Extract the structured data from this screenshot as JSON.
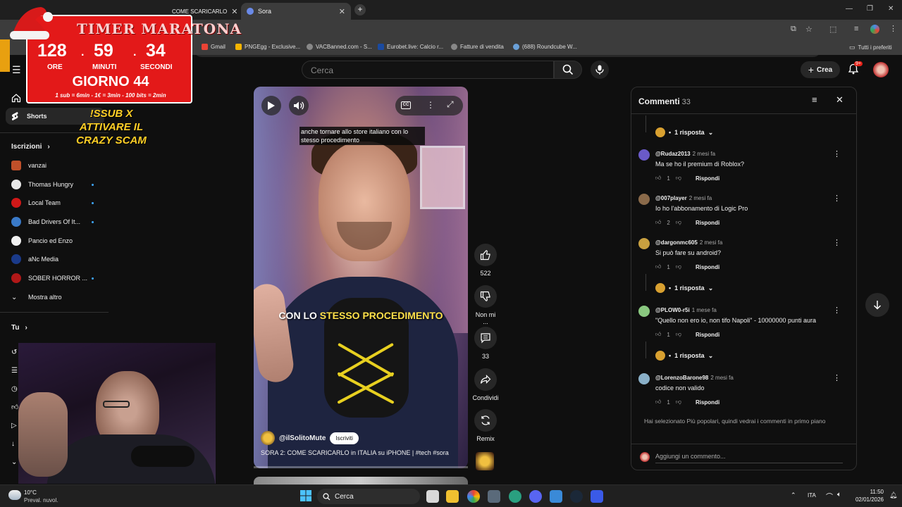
{
  "browser": {
    "tabs": [
      {
        "label": "COME SCARICARLO"
      },
      {
        "label": "Sora"
      }
    ],
    "bookmarks": [
      {
        "label": "Gmail",
        "color": "#ea4335"
      },
      {
        "label": "PNGEgg - Exclusive...",
        "color": "#f5b400"
      },
      {
        "label": "VACBanned.com - S...",
        "color": "#888888"
      },
      {
        "label": "Eurobet.live: Calcio r...",
        "color": "#1a4aa0"
      },
      {
        "label": "Fatture di vendita",
        "color": "#888888"
      },
      {
        "label": "(688) Roundcube W...",
        "color": "#6aa0d8"
      }
    ],
    "bookmarks_folder": "Tutti i preferiti"
  },
  "header": {
    "search_placeholder": "Cerca",
    "create_label": "Crea",
    "notifications_badge": "9+"
  },
  "sidebar": {
    "shorts": "Shorts",
    "subscriptions_title": "Iscrizioni",
    "channels": [
      {
        "name": "vanzai",
        "color": "#c0502a",
        "dot": false
      },
      {
        "name": "Thomas Hungry",
        "color": "#e8e8e8",
        "dot": true
      },
      {
        "name": "Local Team",
        "color": "#d01818",
        "dot": true
      },
      {
        "name": "Bad Drivers Of It...",
        "color": "#3a7ac8",
        "dot": true
      },
      {
        "name": "Pancio ed Enzo",
        "color": "#f0f0f0",
        "dot": false
      },
      {
        "name": "aNc Media",
        "color": "#1a3a8a",
        "dot": false
      },
      {
        "name": "SOBER HORROR ...",
        "color": "#b01818",
        "dot": true
      }
    ],
    "show_more": "Mostra altro",
    "you_title": "Tu"
  },
  "overlay": {
    "timer_title": "TIMER MARATONA",
    "hours": "128",
    "minutes": "59",
    "seconds": "34",
    "hours_label": "ORE",
    "minutes_label": "MINUTI",
    "seconds_label": "SECONDI",
    "day": "GIORNO 44",
    "rules": "1 sub = 6min - 1€ = 3min - 100 bits = 2min",
    "promo_line1": "!SSUB X",
    "promo_line2": "ATTIVARE IL",
    "promo_line3": "CRAZY SCAM"
  },
  "video": {
    "subtitle": "anche tornare allo store italiano con lo stesso procedimento",
    "caption_white": "CON LO ",
    "caption_yellow": "STESSO PROCEDIMENTO",
    "channel": "@ilSolitoMute",
    "subscribe": "Iscriviti",
    "title": "SORA 2: COME SCARICARLO in ITALIA su iPHONE | #tech #sora",
    "progress": 0.0,
    "likes": "522",
    "dislike_label": "Non mi ...",
    "comments_count": "33",
    "share_label": "Condividi",
    "remix_label": "Remix"
  },
  "comments": {
    "title": "Commenti",
    "count": "33",
    "reply_label": "1 risposta",
    "reply_action": "Rispondi",
    "items": [
      {
        "user": "@Rudaz2013",
        "time": "2 mesi fa",
        "text": "Ma se ho il premium di Roblox?",
        "likes": "1",
        "color": "#6a5ac8"
      },
      {
        "user": "@007player",
        "time": "2 mesi fa",
        "text": "Io ho l'abbonamento di Logic Pro",
        "likes": "2",
        "color": "#8a6a4a"
      },
      {
        "user": "@dargonmc605",
        "time": "2 mesi fa",
        "text": "Si può fare su android?",
        "likes": "1",
        "color": "#c8a040"
      },
      {
        "user": "@PLOW0-r5i",
        "time": "1 mese fa",
        "text": "\"Quello non ero io, non tifo Napoli\" - 10000000 punti aura",
        "likes": "1",
        "color": "#8ac880"
      },
      {
        "user": "@LorenzoBarone98",
        "time": "2 mesi fa",
        "text": "codice non valido",
        "likes": "1",
        "color": "#8ab0c8"
      }
    ],
    "sort_note": "Hai selezionato Più popolari, quindi vedrai i commenti in primo piano",
    "add_placeholder": "Aggiungi un commento..."
  },
  "taskbar": {
    "weather_temp": "10°C",
    "weather_desc": "Preval. nuvol.",
    "search_label": "Cerca",
    "language": "ITA",
    "time": "11:50",
    "date": "02/01/2026"
  }
}
